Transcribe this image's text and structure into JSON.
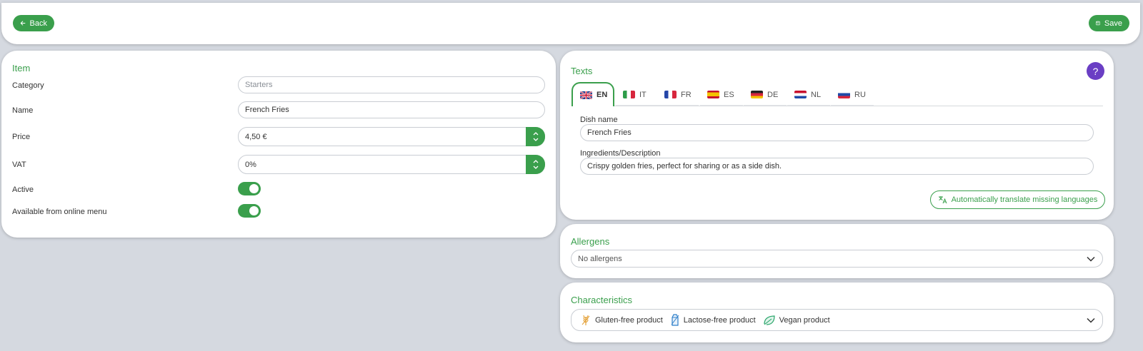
{
  "topbar": {
    "back_label": "Back",
    "save_label": "Save"
  },
  "item": {
    "title": "Item",
    "category": {
      "label": "Category",
      "placeholder": "Starters"
    },
    "name": {
      "label": "Name",
      "value": "French Fries"
    },
    "price": {
      "label": "Price",
      "value": "4,50 €"
    },
    "vat": {
      "label": "VAT",
      "value": "0%"
    },
    "active": {
      "label": "Active",
      "on": true
    },
    "online": {
      "label": "Available from online menu",
      "on": true
    }
  },
  "texts": {
    "title": "Texts",
    "help_label": "?",
    "tabs": [
      {
        "code": "EN",
        "flag": "uk-flag-icon",
        "active": true
      },
      {
        "code": "IT",
        "flag": "italy-flag-icon"
      },
      {
        "code": "FR",
        "flag": "france-flag-icon"
      },
      {
        "code": "ES",
        "flag": "spain-flag-icon"
      },
      {
        "code": "DE",
        "flag": "germany-flag-icon"
      },
      {
        "code": "NL",
        "flag": "netherlands-flag-icon"
      },
      {
        "code": "RU",
        "flag": "russia-flag-icon"
      }
    ],
    "dish_name": {
      "label": "Dish name",
      "value": "French Fries"
    },
    "description": {
      "label": "Ingredients/Description",
      "value": "Crispy golden fries, perfect for sharing or as a side dish."
    },
    "translate_label": "Automatically translate missing languages"
  },
  "allergens": {
    "title": "Allergens",
    "value": "No allergens"
  },
  "characteristics": {
    "title": "Characteristics",
    "items": [
      {
        "label": "Gluten-free product",
        "icon": "wheat-icon"
      },
      {
        "label": "Lactose-free product",
        "icon": "milk-carton-icon"
      },
      {
        "label": "Vegan product",
        "icon": "leaf-icon"
      }
    ]
  },
  "colors": {
    "accent": "#3a9f4c",
    "help": "#6a3ec4",
    "background": "#d5d9e0"
  }
}
